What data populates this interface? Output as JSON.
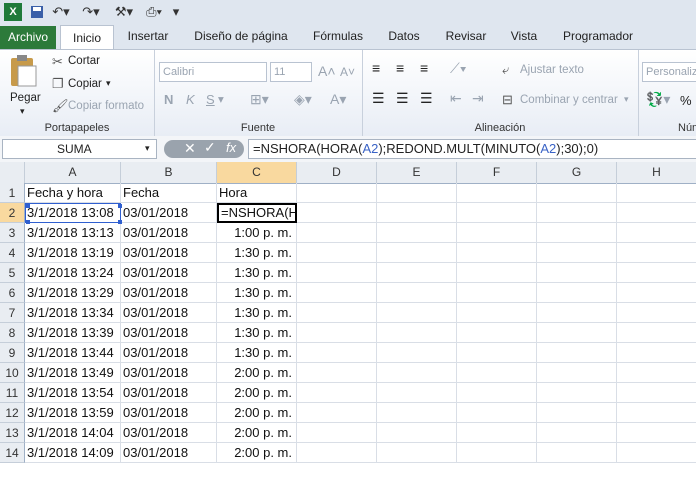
{
  "qat": {
    "icons": [
      "excel-icon",
      "save-icon",
      "undo-icon",
      "redo-icon",
      "format-painter-icon",
      "print-preview-icon",
      "customize-icon"
    ]
  },
  "tabs": [
    "Archivo",
    "Inicio",
    "Insertar",
    "Diseño de página",
    "Fórmulas",
    "Datos",
    "Revisar",
    "Vista",
    "Programador"
  ],
  "ribbon": {
    "clipboard": {
      "paste": "Pegar",
      "cut": "Cortar",
      "copy": "Copiar",
      "format_painter": "Copiar formato",
      "label": "Portapapeles"
    },
    "font": {
      "name": "Calibri",
      "size": "11",
      "bold": "N",
      "italic": "K",
      "underline": "S",
      "label": "Fuente"
    },
    "alignment": {
      "wrap": "Ajustar texto",
      "merge": "Combinar y centrar",
      "label": "Alineación"
    },
    "number": {
      "format": "Personaliza",
      "label": "Núm",
      "percent": "%"
    }
  },
  "formula_bar": {
    "name_box": "SUMA",
    "fx": "fx",
    "formula_parts": [
      [
        "=NSHORA(HORA(",
        ""
      ],
      [
        "A2",
        "ref"
      ],
      [
        ");REDOND.MULT(MINUTO(",
        ""
      ],
      [
        "A2",
        "ref"
      ],
      [
        ");30);0)",
        ""
      ]
    ]
  },
  "columns": [
    "A",
    "B",
    "C",
    "D",
    "E",
    "F",
    "G",
    "H"
  ],
  "rows": [
    [
      "Fecha y hora",
      "Fecha",
      "Hora"
    ],
    [
      "3/1/2018 13:08",
      "03/01/2018",
      "=NSHORA(H("
    ],
    [
      "3/1/2018 13:13",
      "03/01/2018",
      "1:00 p. m."
    ],
    [
      "3/1/2018 13:19",
      "03/01/2018",
      "1:30 p. m."
    ],
    [
      "3/1/2018 13:24",
      "03/01/2018",
      "1:30 p. m."
    ],
    [
      "3/1/2018 13:29",
      "03/01/2018",
      "1:30 p. m."
    ],
    [
      "3/1/2018 13:34",
      "03/01/2018",
      "1:30 p. m."
    ],
    [
      "3/1/2018 13:39",
      "03/01/2018",
      "1:30 p. m."
    ],
    [
      "3/1/2018 13:44",
      "03/01/2018",
      "1:30 p. m."
    ],
    [
      "3/1/2018 13:49",
      "03/01/2018",
      "2:00 p. m."
    ],
    [
      "3/1/2018 13:54",
      "03/01/2018",
      "2:00 p. m."
    ],
    [
      "3/1/2018 13:59",
      "03/01/2018",
      "2:00 p. m."
    ],
    [
      "3/1/2018 14:04",
      "03/01/2018",
      "2:00 p. m."
    ],
    [
      "3/1/2018 14:09",
      "03/01/2018",
      "2:00 p. m."
    ]
  ],
  "row_numbers": [
    "1",
    "2",
    "3",
    "4",
    "5",
    "6",
    "7",
    "8",
    "9",
    "10",
    "11",
    "12",
    "13",
    "14"
  ]
}
